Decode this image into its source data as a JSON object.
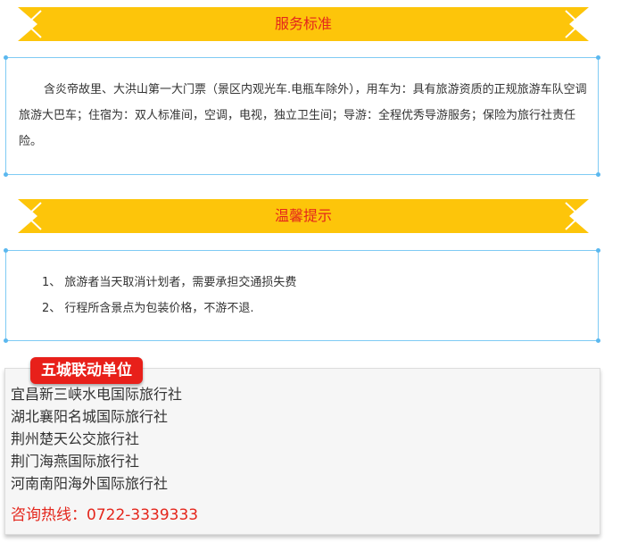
{
  "colors": {
    "banner_gold": "#fdc50a",
    "banner_title": "#e4261c",
    "box_border": "#7fcbf4",
    "tag_red": "#e8201a",
    "hotline_red": "#e4261c"
  },
  "service_section": {
    "title": "服务标准",
    "body": "含炎帝故里、大洪山第一大门票（景区内观光车.电瓶车除外），用车为：具有旅游资质的正规旅游车队空调旅游大巴车；住宿为：双人标准间，空调，电视，独立卫生间；导游：全程优秀导游服务；保险为旅行社责任险。"
  },
  "tips_section": {
    "title": "温馨提示",
    "items": [
      "1、 旅游者当天取消计划者，需要承担交通损失费",
      "2、 行程所含景点为包装价格，不游不退."
    ]
  },
  "partners_section": {
    "tag": "五城联动单位",
    "agencies": [
      "宜昌新三峡水电国际旅行社",
      "湖北襄阳名城国际旅行社",
      "荆州楚天公交旅行社",
      "荆门海燕国际旅行社",
      "河南南阳海外国际旅行社"
    ],
    "hotline": "咨询热线：0722-3339333"
  }
}
